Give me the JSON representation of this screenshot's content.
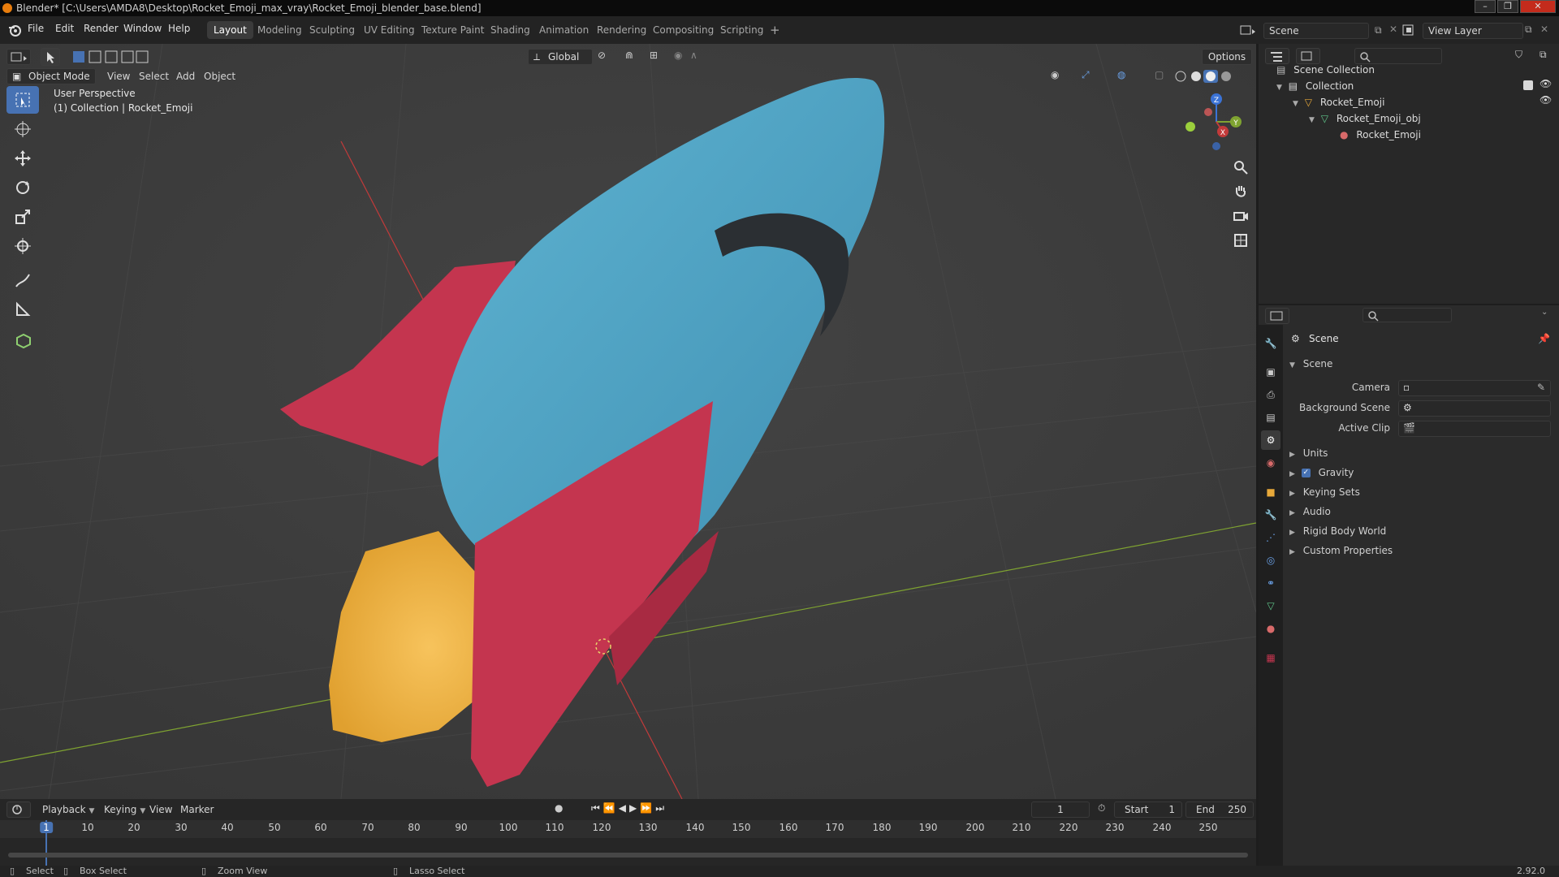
{
  "window": {
    "title": "Blender* [C:\\Users\\AMDA8\\Desktop\\Rocket_Emoji_max_vray\\Rocket_Emoji_blender_base.blend]",
    "minimize": "–",
    "maximize": "❐",
    "close": "✕"
  },
  "menu": [
    "File",
    "Edit",
    "Render",
    "Window",
    "Help"
  ],
  "workspaces": [
    "Layout",
    "Modeling",
    "Sculpting",
    "UV Editing",
    "Texture Paint",
    "Shading",
    "Animation",
    "Rendering",
    "Compositing",
    "Scripting",
    "+"
  ],
  "active_workspace": "Layout",
  "scene_field": "Scene",
  "view_layer_field": "View Layer",
  "viewport": {
    "mode": "Object Mode",
    "menus": [
      "View",
      "Select",
      "Add",
      "Object"
    ],
    "orientation": "Global",
    "options": "Options",
    "info_line1": "User Perspective",
    "info_line2": "(1) Collection | Rocket_Emoji",
    "axes": {
      "x": "X",
      "y": "Y",
      "z": "Z"
    }
  },
  "outliner": {
    "rows": [
      {
        "label": "Scene Collection"
      },
      {
        "label": "Collection"
      },
      {
        "label": "Rocket_Emoji"
      },
      {
        "label": "Rocket_Emoji_obj"
      },
      {
        "label": "Rocket_Emoji"
      }
    ]
  },
  "properties": {
    "header": "Scene",
    "section": "Scene",
    "fields": [
      {
        "label": "Camera"
      },
      {
        "label": "Background Scene"
      },
      {
        "label": "Active Clip"
      }
    ],
    "panels": [
      {
        "label": "Units"
      },
      {
        "label": "Gravity",
        "checked": true
      },
      {
        "label": "Keying Sets"
      },
      {
        "label": "Audio"
      },
      {
        "label": "Rigid Body World"
      },
      {
        "label": "Custom Properties"
      }
    ]
  },
  "timeline": {
    "menus": [
      "Playback",
      "Keying",
      "View",
      "Marker"
    ],
    "current_frame": "1",
    "start_label": "Start",
    "start": "1",
    "end_label": "End",
    "end": "250",
    "ticks": [
      "1",
      "10",
      "20",
      "30",
      "40",
      "50",
      "60",
      "70",
      "80",
      "90",
      "100",
      "110",
      "120",
      "130",
      "140",
      "150",
      "160",
      "170",
      "180",
      "190",
      "200",
      "210",
      "220",
      "230",
      "240",
      "250"
    ]
  },
  "status": {
    "select": "Select",
    "box_select": "Box Select",
    "zoom_view": "Zoom View",
    "lasso_select": "Lasso Select",
    "version": "2.92.0"
  },
  "colors": {
    "accent": "#4772b3",
    "rocket_body": "#4fa3c4",
    "rocket_fin": "#c4354f",
    "rocket_flame": "#e8a93a",
    "x_axis": "#c23a3a",
    "y_axis": "#7fa331",
    "z_axis": "#3b73d6"
  }
}
